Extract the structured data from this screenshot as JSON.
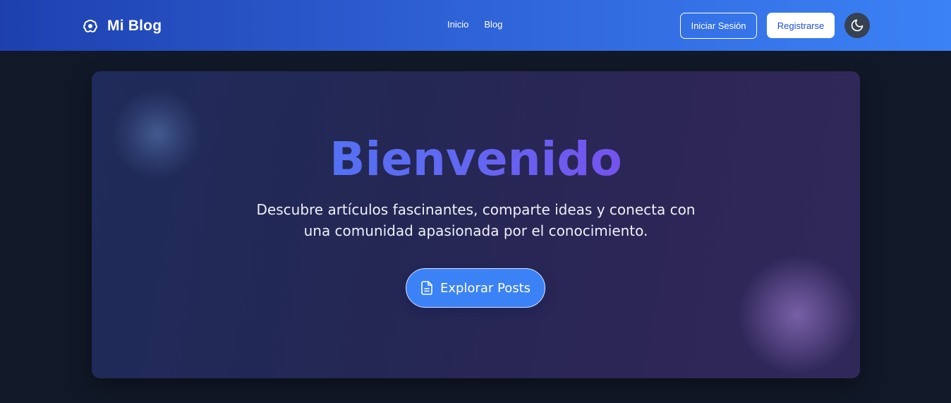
{
  "nav": {
    "brand": "Mi Blog",
    "brand_icon": "brain-icon",
    "links": [
      "Inicio",
      "Blog"
    ],
    "login_label": "Iniciar Sesión",
    "register_label": "Registrarse",
    "theme_icon": "moon-icon"
  },
  "hero": {
    "title": "Bienvenido",
    "description": "Descubre artículos fascinantes, comparte ideas y conecta con una comunidad apasionada por el conocimiento.",
    "cta_label": "Explorar Posts",
    "cta_icon": "document-icon"
  },
  "colors": {
    "nav_gradient_start": "#1e40af",
    "nav_gradient_end": "#3b82f6",
    "page_background": "#111827",
    "title_gradient_start": "#3b82f6",
    "title_gradient_end": "#9333ea",
    "cta_background": "#3b82f6"
  }
}
